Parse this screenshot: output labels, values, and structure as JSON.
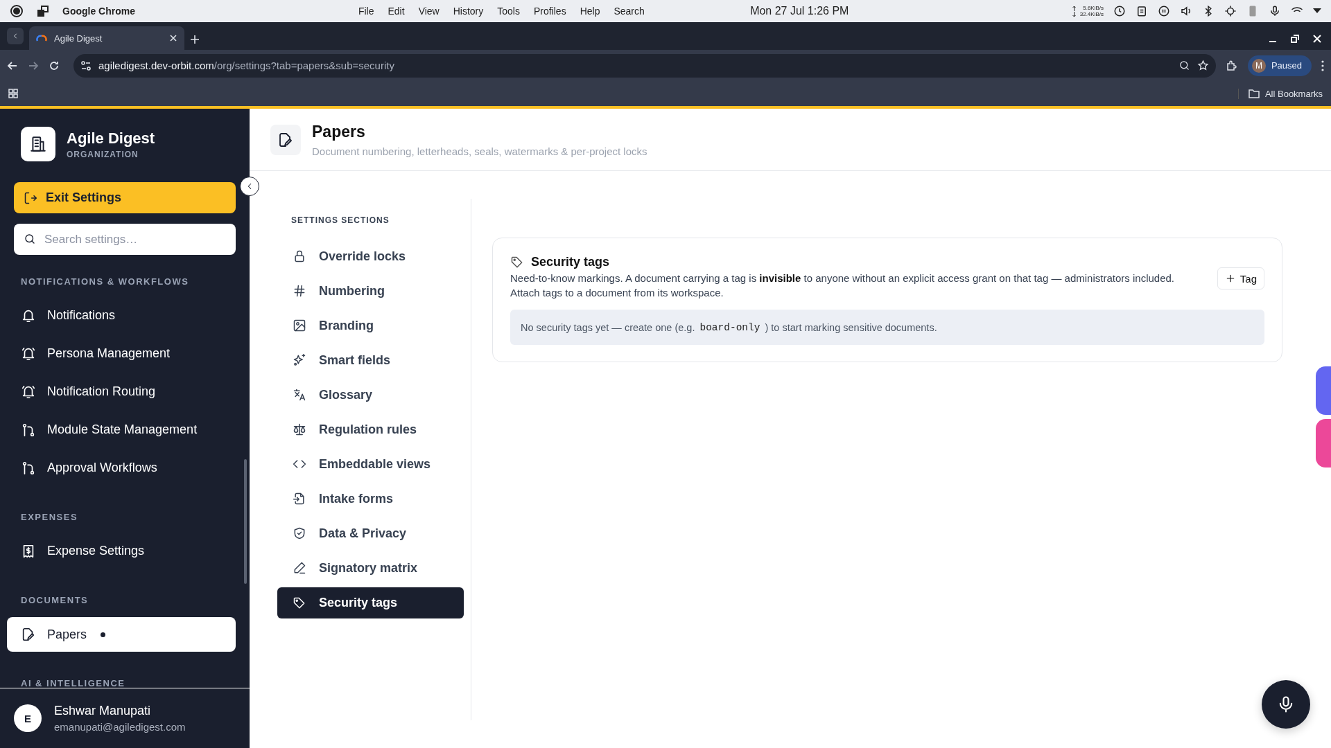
{
  "os_bar": {
    "app_name": "Google Chrome",
    "menus": [
      "File",
      "Edit",
      "View",
      "History",
      "Tools",
      "Profiles",
      "Help",
      "Search"
    ],
    "clock": "Mon 27 Jul  1:26 PM",
    "upload_rate": "5.6KiB/s",
    "download_rate": "32.4KiB/s"
  },
  "browser": {
    "tab_title": "Agile Digest",
    "url_host": "agiledigest.dev-orbit.com",
    "url_path": "/org/settings?tab=papers&sub=security",
    "profile_initial": "M",
    "profile_status": "Paused",
    "bookmarks_label": "All Bookmarks"
  },
  "sidebar": {
    "org_name": "Agile Digest",
    "org_type": "ORGANIZATION",
    "exit_button": "Exit Settings",
    "search_placeholder": "Search settings…",
    "groups": [
      {
        "label": "NOTIFICATIONS & WORKFLOWS",
        "items": [
          {
            "label": "Notifications",
            "selected": false
          },
          {
            "label": "Persona Management",
            "selected": false
          },
          {
            "label": "Notification Routing",
            "selected": false
          },
          {
            "label": "Module State Management",
            "selected": false
          },
          {
            "label": "Approval Workflows",
            "selected": false
          }
        ]
      },
      {
        "label": "EXPENSES",
        "items": [
          {
            "label": "Expense Settings",
            "selected": false
          }
        ]
      },
      {
        "label": "DOCUMENTS",
        "items": [
          {
            "label": "Papers",
            "selected": true,
            "dot": true
          }
        ]
      },
      {
        "label": "AI & INTELLIGENCE"
      }
    ],
    "user": {
      "initial": "E",
      "name": "Eshwar Manupati",
      "email": "emanupati@agiledigest.com"
    }
  },
  "page_header": {
    "title": "Papers",
    "subtitle": "Document numbering, letterheads, seals, watermarks & per-project locks"
  },
  "sections": {
    "heading": "SETTINGS SECTIONS",
    "items": [
      {
        "label": "Override locks",
        "selected": false
      },
      {
        "label": "Numbering",
        "selected": false
      },
      {
        "label": "Branding",
        "selected": false
      },
      {
        "label": "Smart fields",
        "selected": false
      },
      {
        "label": "Glossary",
        "selected": false
      },
      {
        "label": "Regulation rules",
        "selected": false
      },
      {
        "label": "Embeddable views",
        "selected": false
      },
      {
        "label": "Intake forms",
        "selected": false
      },
      {
        "label": "Data & Privacy",
        "selected": false
      },
      {
        "label": "Signatory matrix",
        "selected": false
      },
      {
        "label": "Security tags",
        "selected": true
      }
    ]
  },
  "security_tags": {
    "title": "Security tags",
    "description": "Need-to-know markings. A document carrying a tag is **invisible** to anyone without an explicit access grant on that tag — administrators included. Attach tags to a document from its workspace.",
    "add_button": "Tag",
    "empty_before": "No security tags yet — create one (e.g.",
    "example_code": "board-only",
    "empty_after": ") to start marking sensitive documents."
  }
}
